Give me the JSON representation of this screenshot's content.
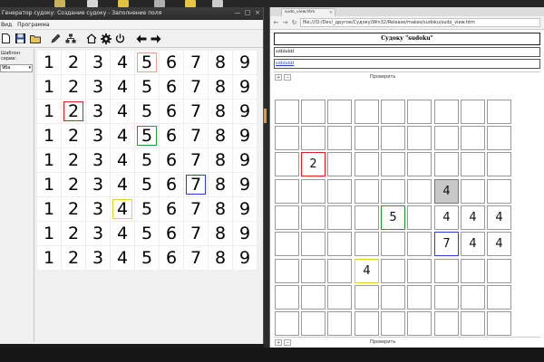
{
  "left_window": {
    "title": "Генератор судоку: Создание судоку - Заполнение поля",
    "menu": [
      "Вид",
      "Программа"
    ],
    "toolbar_icons": [
      "new-file-icon",
      "save-icon",
      "open-folder-icon",
      "pen-icon",
      "tree-icon",
      "home-icon",
      "gear-icon",
      "power-icon",
      "arrow-left-icon",
      "arrow-right-icon"
    ],
    "side_label": "Шаблон серии:",
    "side_select_value": "9ба",
    "grid_row": [
      "1",
      "2",
      "3",
      "4",
      "5",
      "6",
      "7",
      "8",
      "9"
    ],
    "highlights": [
      {
        "row": 0,
        "col": 4,
        "color": "#e8a090"
      },
      {
        "row": 2,
        "col": 1,
        "color": "#e02020"
      },
      {
        "row": 3,
        "col": 4,
        "color": "#1e9e2e"
      },
      {
        "row": 5,
        "col": 6,
        "color": "#2b3fe0"
      },
      {
        "row": 6,
        "col": 3,
        "color": "#e8d020"
      }
    ]
  },
  "browser": {
    "tab_title": "sudo_view.htm",
    "url": "file:///D:/Dev/_другое/Судоку/Win32/Release/makes/sudoku/sudo_view.htm",
    "page_title": "Судоку \"sudoku\"",
    "text_line": "sdfdsfdf",
    "link_line": "sdfdsfdf",
    "plus_label": "+",
    "minus_label": "−",
    "check_label": "Проверить",
    "cells": [
      {
        "block": 0,
        "idx": 7,
        "value": "2",
        "color": "#e02020"
      },
      {
        "block": 4,
        "idx": 4,
        "value": "5",
        "color": "#1e9e2e"
      },
      {
        "block": 5,
        "idx": 0,
        "value": "4",
        "selected": true
      },
      {
        "block": 5,
        "idx": 3,
        "value": "4"
      },
      {
        "block": 5,
        "idx": 4,
        "value": "4"
      },
      {
        "block": 5,
        "idx": 5,
        "value": "4"
      },
      {
        "block": 5,
        "idx": 6,
        "value": "7",
        "color": "#2b3fe0"
      },
      {
        "block": 5,
        "idx": 7,
        "value": "4"
      },
      {
        "block": 5,
        "idx": 8,
        "value": "4"
      },
      {
        "block": 7,
        "idx": 0,
        "value": "4",
        "color": "#e8d020"
      }
    ]
  }
}
